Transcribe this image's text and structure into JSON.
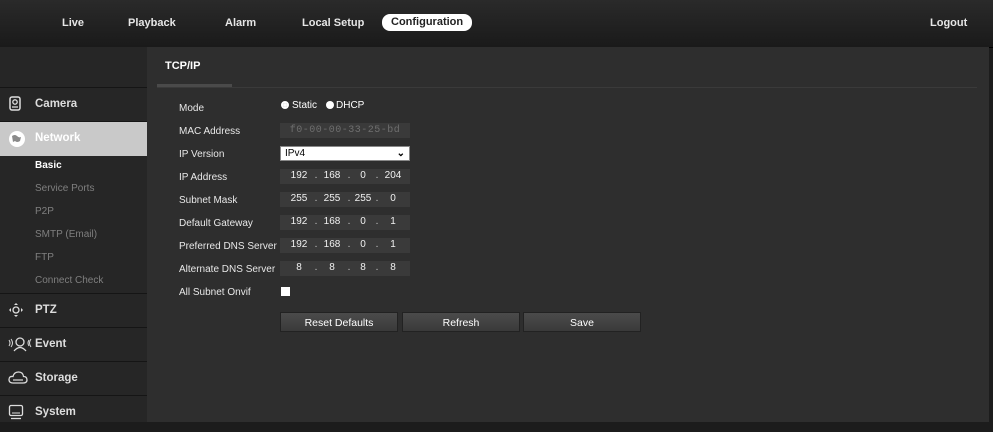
{
  "nav": {
    "tabs": [
      "Live",
      "Playback",
      "Alarm",
      "Local Setup",
      "Configuration"
    ],
    "logout": "Logout"
  },
  "sidebar": {
    "sections": [
      {
        "label": "Camera",
        "icon": "camera-icon"
      },
      {
        "label": "Network",
        "icon": "network-globe-icon"
      },
      {
        "label": "PTZ",
        "icon": "ptz-icon"
      },
      {
        "label": "Event",
        "icon": "event-person-icon"
      },
      {
        "label": "Storage",
        "icon": "storage-cloud-icon"
      },
      {
        "label": "System",
        "icon": "system-monitor-icon"
      }
    ],
    "network_sub": [
      "Basic",
      "Service Ports",
      "P2P",
      "SMTP (Email)",
      "FTP",
      "Connect Check"
    ]
  },
  "main": {
    "tab": "TCP/IP",
    "form": {
      "mode_label": "Mode",
      "mode_static": "Static",
      "mode_dhcp": "DHCP",
      "mac_label": "MAC Address",
      "mac_value": "f0-00-00-33-25-bd",
      "ipversion_label": "IP Version",
      "ipversion_value": "IPv4",
      "ip_label": "IP Address",
      "ip": [
        "192",
        "168",
        "0",
        "204"
      ],
      "subnet_label": "Subnet Mask",
      "subnet": [
        "255",
        "255",
        "255",
        "0"
      ],
      "gateway_label": "Default Gateway",
      "gateway": [
        "192",
        "168",
        "0",
        "1"
      ],
      "pdns_label": "Preferred DNS Server",
      "pdns": [
        "192",
        "168",
        "0",
        "1"
      ],
      "adns_label": "Alternate DNS Server",
      "adns": [
        "8",
        "8",
        "8",
        "8"
      ],
      "onvif_label": "All Subnet Onvif"
    },
    "buttons": {
      "reset": "Reset Defaults",
      "refresh": "Refresh",
      "save": "Save"
    }
  }
}
